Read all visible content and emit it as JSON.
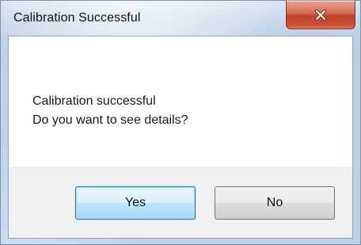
{
  "dialog": {
    "title": "Calibration Successful",
    "message_line1": "Calibration successful",
    "message_line2": "Do you want to see details?",
    "buttons": {
      "yes_label": "Yes",
      "no_label": "No"
    },
    "close_icon": "close-x-icon"
  },
  "colors": {
    "close_button": "#c84d34",
    "default_button_border": "#3c7fb1",
    "dialog_background": "#ffffff",
    "button_area_background": "#f0f0f0"
  }
}
